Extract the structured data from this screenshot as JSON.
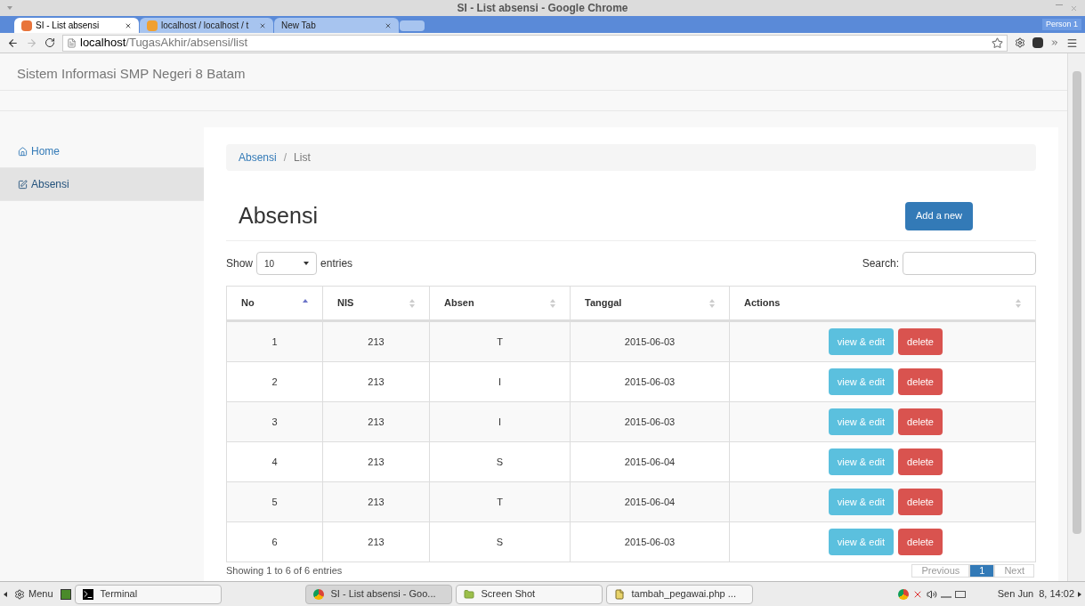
{
  "window": {
    "title": "SI - List absensi - Google Chrome"
  },
  "tabs": [
    {
      "title": "SI - List absensi",
      "selected": true,
      "kind": "site"
    },
    {
      "title": "localhost / localhost / t",
      "selected": false,
      "kind": "pma"
    },
    {
      "title": "New Tab",
      "selected": false,
      "kind": "blank"
    }
  ],
  "profile": "Person 1",
  "address": {
    "host": "localhost",
    "path": "/TugasAkhir/absensi/list"
  },
  "navbar": {
    "brand": "Sistem Informasi SMP Negeri 8 Batam"
  },
  "sidebar": {
    "items": [
      {
        "label": "Home",
        "kind": "home",
        "selected": false
      },
      {
        "label": "Absensi",
        "kind": "edit",
        "selected": true
      }
    ]
  },
  "breadcrumb": {
    "items": [
      "Absensi",
      "List"
    ],
    "separator": "/"
  },
  "heading": "Absensi",
  "add_button": "Add a new",
  "length": {
    "before": "Show",
    "value": "10",
    "after": "entries"
  },
  "search": {
    "label": "Search:"
  },
  "table": {
    "columns": [
      {
        "label": "No",
        "sorted": true
      },
      {
        "label": "NIS",
        "sorted": false
      },
      {
        "label": "Absen",
        "sorted": false
      },
      {
        "label": "Tanggal",
        "sorted": false
      },
      {
        "label": "Actions",
        "sorted": false
      }
    ],
    "rows": [
      {
        "cells": [
          "1",
          "213",
          "T",
          "2015-06-03"
        ],
        "actions": [
          "view & edit",
          "delete"
        ]
      },
      {
        "cells": [
          "2",
          "213",
          "I",
          "2015-06-03"
        ],
        "actions": [
          "view & edit",
          "delete"
        ]
      },
      {
        "cells": [
          "3",
          "213",
          "I",
          "2015-06-03"
        ],
        "actions": [
          "view & edit",
          "delete"
        ]
      },
      {
        "cells": [
          "4",
          "213",
          "S",
          "2015-06-04"
        ],
        "actions": [
          "view & edit",
          "delete"
        ]
      },
      {
        "cells": [
          "5",
          "213",
          "T",
          "2015-06-04"
        ],
        "actions": [
          "view & edit",
          "delete"
        ]
      },
      {
        "cells": [
          "6",
          "213",
          "S",
          "2015-06-03"
        ],
        "actions": [
          "view & edit",
          "delete"
        ]
      }
    ]
  },
  "info": "Showing 1 to 6 of 6 entries",
  "pagination": [
    {
      "label": "Previous",
      "selected": false
    },
    {
      "label": "1",
      "selected": true
    },
    {
      "label": "Next",
      "selected": false
    }
  ],
  "taskbar": {
    "menu": "Menu",
    "items": [
      {
        "label": "Terminal",
        "kind": "terminal",
        "selected": false
      },
      {
        "label": "SI - List absensi - Goo...",
        "kind": "chrome",
        "selected": true
      },
      {
        "label": "Screen Shot",
        "kind": "folder",
        "selected": false
      },
      {
        "label": "tambah_pegawai.php ...",
        "kind": "file",
        "selected": false
      }
    ],
    "clock": "Sen Jun  8, 14:02"
  }
}
